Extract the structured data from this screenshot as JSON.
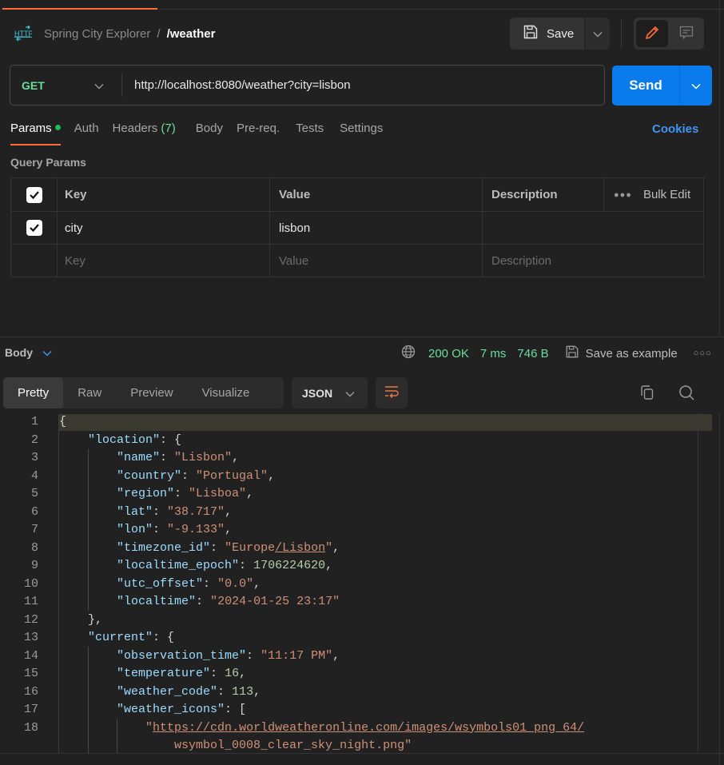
{
  "header": {
    "collection": "Spring City Explorer",
    "separator": "/",
    "request_name": "/weather",
    "save_label": "Save"
  },
  "request": {
    "method": "GET",
    "url": "http://localhost:8080/weather?city=lisbon",
    "send_label": "Send"
  },
  "tabs": [
    {
      "label": "Params",
      "active": true,
      "dot": true
    },
    {
      "label": "Auth"
    },
    {
      "label": "Headers",
      "count": "(7)"
    },
    {
      "label": "Body"
    },
    {
      "label": "Pre-req."
    },
    {
      "label": "Tests"
    },
    {
      "label": "Settings"
    }
  ],
  "cookies_label": "Cookies",
  "query_params": {
    "title": "Query Params",
    "headers": {
      "key": "Key",
      "value": "Value",
      "description": "Description",
      "bulk_edit": "Bulk Edit"
    },
    "rows": [
      {
        "checked": true,
        "key": "city",
        "value": "lisbon",
        "description": ""
      }
    ],
    "placeholders": {
      "key": "Key",
      "value": "Value",
      "description": "Description"
    }
  },
  "response": {
    "section_label": "Body",
    "status": "200 OK",
    "time": "7 ms",
    "size": "746 B",
    "save_example_label": "Save as example",
    "view_tabs": [
      "Pretty",
      "Raw",
      "Preview",
      "Visualize"
    ],
    "active_view": "Pretty",
    "format": "JSON"
  },
  "code": {
    "lines": [
      {
        "n": "1"
      },
      {
        "n": "2"
      },
      {
        "n": "3"
      },
      {
        "n": "4"
      },
      {
        "n": "5"
      },
      {
        "n": "6"
      },
      {
        "n": "7"
      },
      {
        "n": "8"
      },
      {
        "n": "9"
      },
      {
        "n": "10"
      },
      {
        "n": "11"
      },
      {
        "n": "12"
      },
      {
        "n": "13"
      },
      {
        "n": "14"
      },
      {
        "n": "15"
      },
      {
        "n": "16"
      },
      {
        "n": "17"
      },
      {
        "n": "18"
      }
    ],
    "tokens": {
      "l2k": "\"location\"",
      "l3k": "\"name\"",
      "l3v": "\"Lisbon\"",
      "l4k": "\"country\"",
      "l4v": "\"Portugal\"",
      "l5k": "\"region\"",
      "l5v": "\"Lisboa\"",
      "l6k": "\"lat\"",
      "l6v": "\"38.717\"",
      "l7k": "\"lon\"",
      "l7v": "\"-9.133\"",
      "l8k": "\"timezone_id\"",
      "l8v1": "\"Europe",
      "l8v2": "/Lisbon",
      "l8v3": "\"",
      "l9k": "\"localtime_epoch\"",
      "l9v": "1706224620",
      "l10k": "\"utc_offset\"",
      "l10v": "\"0.0\"",
      "l11k": "\"localtime\"",
      "l11v": "\"2024-01-25 23:17\"",
      "l13k": "\"current\"",
      "l14k": "\"observation_time\"",
      "l14v": "\"11:17 PM\"",
      "l15k": "\"temperature\"",
      "l15v": "16",
      "l16k": "\"weather_code\"",
      "l16v": "113",
      "l17k": "\"weather_icons\"",
      "l18q": "\"",
      "l18url": "https://cdn.worldweatheronline.com/images/wsymbols01_png_64/",
      "l18b": "wsymbol_0008_clear_sky_night.png\""
    }
  },
  "colors": {
    "accent": "#ff6c37",
    "send": "#097bed",
    "method_get": "#6bdd9a",
    "status_ok": "#6bdd9a",
    "link": "#3e96f0"
  },
  "icons": {
    "app": "http-icon",
    "save": "floppy-disk-icon",
    "edit": "pencil-icon",
    "comment": "comment-icon",
    "globe": "globe-icon",
    "wrap": "word-wrap-icon",
    "copy": "copy-icon",
    "search": "search-icon"
  }
}
